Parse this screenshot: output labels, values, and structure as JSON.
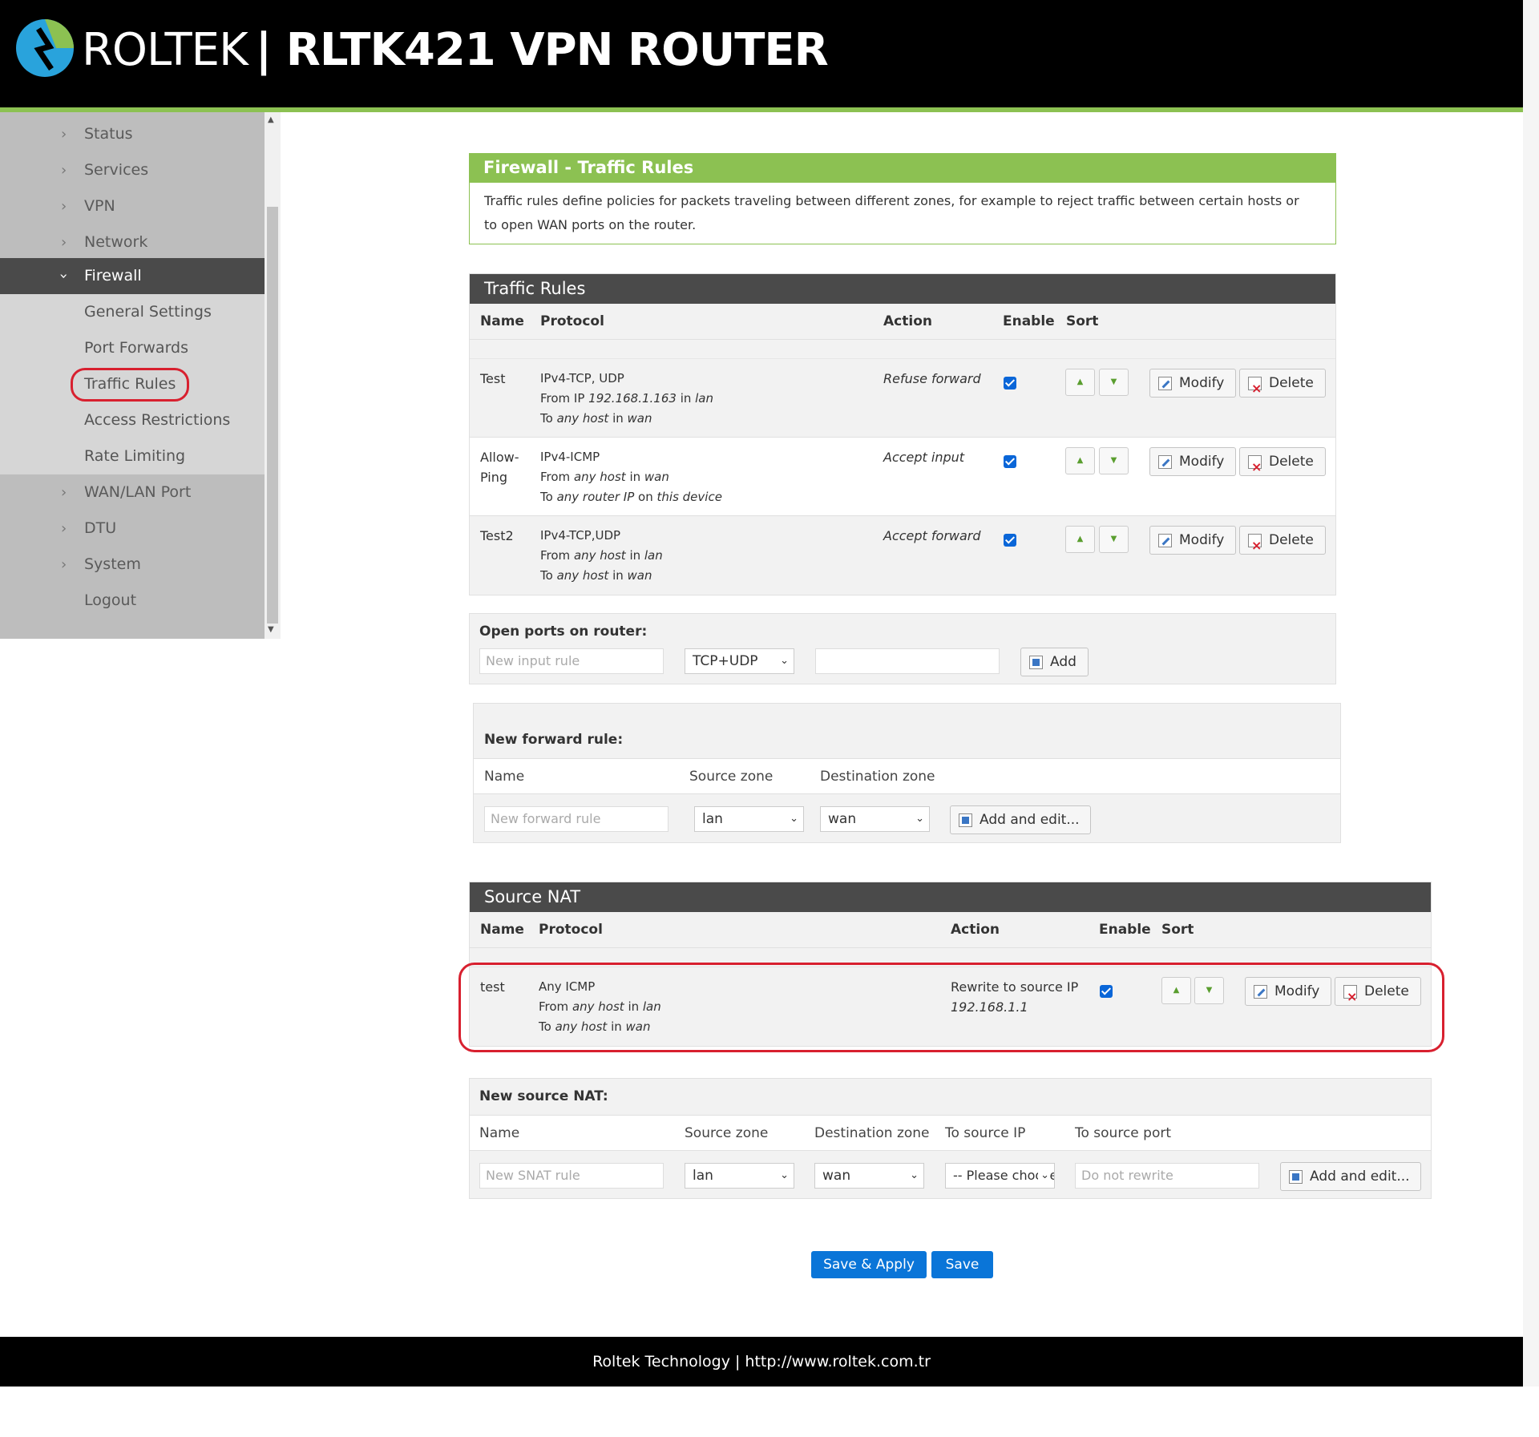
{
  "header": {
    "brand_part1": "ROLTEK",
    "brand_part2": "| RLTK421 VPN ROUTER",
    "logo_icon": "roltek-logo-icon"
  },
  "sidebar": {
    "items": [
      {
        "label": "Status"
      },
      {
        "label": "Services"
      },
      {
        "label": "VPN"
      },
      {
        "label": "Network"
      },
      {
        "label": "Firewall"
      },
      {
        "label": "General Settings"
      },
      {
        "label": "Port Forwards"
      },
      {
        "label": "Traffic Rules"
      },
      {
        "label": "Access Restrictions"
      },
      {
        "label": "Rate Limiting"
      },
      {
        "label": "WAN/LAN Port"
      },
      {
        "label": "DTU"
      },
      {
        "label": "System"
      },
      {
        "label": "Logout"
      }
    ]
  },
  "intro": {
    "title": "Firewall - Traffic Rules",
    "description": "Traffic rules define policies for packets traveling between different zones, for example to reject traffic between certain hosts or to open WAN ports on the router."
  },
  "traffic_rules": {
    "title": "Traffic Rules",
    "columns": {
      "name": "Name",
      "protocol": "Protocol",
      "action": "Action",
      "enable": "Enable",
      "sort": "Sort"
    },
    "rows": [
      {
        "name": "Test",
        "proto_line1": "IPv4-TCP, UDP",
        "from_prefix": "From IP ",
        "from_value": "192.168.1.163",
        "from_in": " in ",
        "from_zone": "lan",
        "to_prefix": "To ",
        "to_value": "any host",
        "to_in": " in ",
        "to_zone": "wan",
        "action": "Refuse forward",
        "enabled": true
      },
      {
        "name": "Allow-Ping",
        "proto_line1": "IPv4-ICMP",
        "from_prefix": "From ",
        "from_value": "any host",
        "from_in": " in ",
        "from_zone": "wan",
        "to_prefix": "To ",
        "to_value": "any router IP",
        "to_in": " on ",
        "to_zone": "this device",
        "action": "Accept input",
        "enabled": true
      },
      {
        "name": "Test2",
        "proto_line1": "IPv4-TCP,UDP",
        "from_prefix": "From ",
        "from_value": "any host",
        "from_in": " in ",
        "from_zone": "lan",
        "to_prefix": "To ",
        "to_value": "any host",
        "to_in": " in ",
        "to_zone": "wan",
        "action": "Accept forward",
        "enabled": true
      }
    ],
    "modify_label": "Modify",
    "delete_label": "Delete"
  },
  "open_ports": {
    "label": "Open ports on router:",
    "name_placeholder": "New input rule",
    "protocol_value": "TCP+UDP",
    "add_label": "Add"
  },
  "new_forward": {
    "label": "New forward rule:",
    "col_name": "Name",
    "col_source": "Source zone",
    "col_dest": "Destination zone",
    "name_placeholder": "New forward rule",
    "source_value": "lan",
    "dest_value": "wan",
    "add_label": "Add and edit..."
  },
  "source_nat": {
    "title": "Source NAT",
    "columns": {
      "name": "Name",
      "protocol": "Protocol",
      "action": "Action",
      "enable": "Enable",
      "sort": "Sort"
    },
    "rows": [
      {
        "name": "test",
        "proto_line1": "Any ICMP",
        "from_prefix": "From ",
        "from_value": "any host",
        "from_in": " in ",
        "from_zone": "lan",
        "to_prefix": "To ",
        "to_value": "any host",
        "to_in": " in ",
        "to_zone": "wan",
        "action_line1": "Rewrite to source IP",
        "action_line2": "192.168.1.1",
        "enabled": true
      }
    ],
    "modify_label": "Modify",
    "delete_label": "Delete"
  },
  "new_snat": {
    "label": "New source NAT:",
    "col_name": "Name",
    "col_source": "Source zone",
    "col_dest": "Destination zone",
    "col_src_ip": "To source IP",
    "col_src_port": "To source port",
    "name_placeholder": "New SNAT rule",
    "source_value": "lan",
    "dest_value": "wan",
    "src_ip_value": "-- Please choose --",
    "src_port_placeholder": "Do not rewrite",
    "add_label": "Add and edit..."
  },
  "actions": {
    "save_apply": "Save & Apply",
    "save": "Save"
  },
  "footer": {
    "text": "Roltek Technology | http://www.roltek.com.tr"
  },
  "colors": {
    "accent_green": "#8cc152",
    "primary_blue": "#0a75d8",
    "highlight_red": "#d8202f"
  }
}
